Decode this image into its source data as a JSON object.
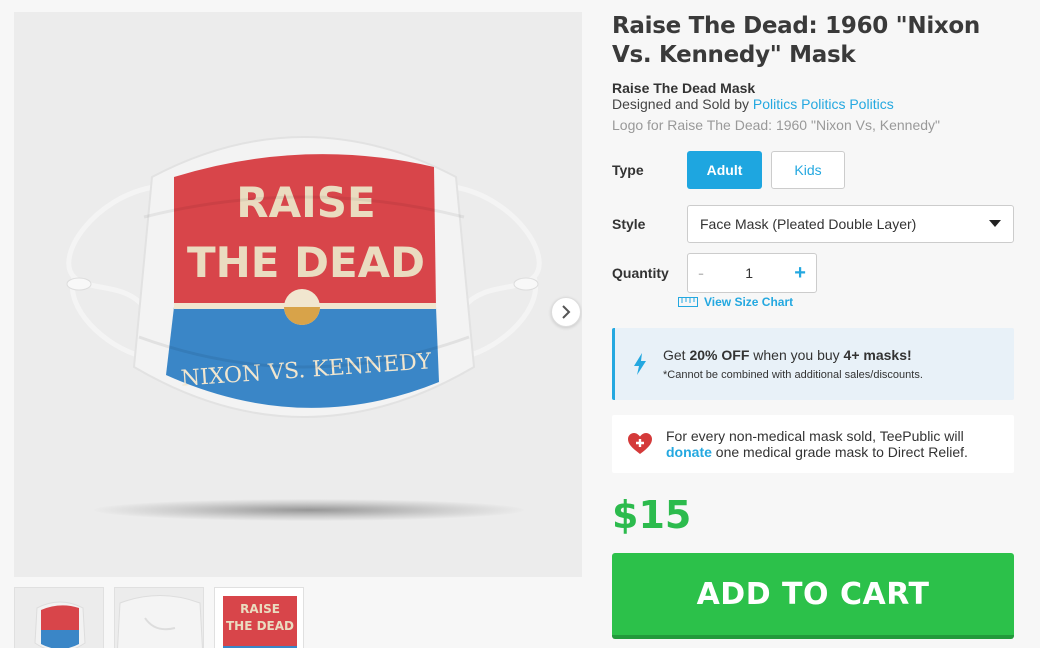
{
  "product": {
    "title": "Raise The Dead: 1960 \"Nixon Vs. Kennedy\" Mask",
    "subtitle": "Raise The Dead Mask",
    "designed_prefix": "Designed and Sold by ",
    "designer": "Politics Politics Politics",
    "logo_caption": "Logo for Raise The Dead: 1960 \"Nixon Vs, Kennedy\""
  },
  "artwork": {
    "line1": "RAISE",
    "line2": "THE DEAD",
    "line3": "NIXON VS. KENNEDY"
  },
  "options": {
    "type_label": "Type",
    "type_adult": "Adult",
    "type_kids": "Kids",
    "style_label": "Style",
    "style_value": "Face Mask (Pleated Double Layer)",
    "quantity_label": "Quantity",
    "quantity_minus": "-",
    "quantity_value": "1",
    "quantity_plus": "+",
    "size_chart": "View Size Chart"
  },
  "promo": {
    "pre": "Get ",
    "discount": "20% OFF",
    "mid": " when you buy ",
    "count": "4+ masks!",
    "note": "*Cannot be combined with additional sales/discounts."
  },
  "donation": {
    "line1": "For every non-medical mask sold, TeePublic will",
    "link": "donate",
    "line2": " one medical grade mask to Direct Relief."
  },
  "price": "$15",
  "cart_label": "ADD TO CART",
  "colors": {
    "accent": "#24a8e0",
    "green": "#2cc14a",
    "art_red": "#d8454a",
    "art_blue": "#3a86c7"
  }
}
